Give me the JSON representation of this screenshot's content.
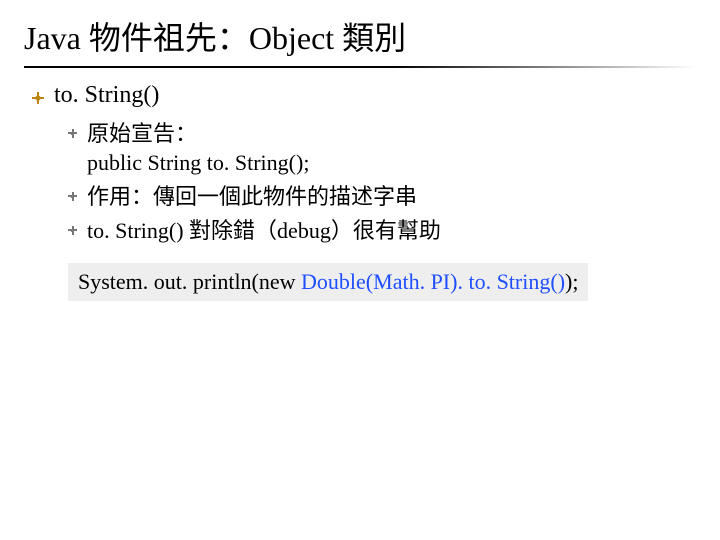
{
  "title": "Java 物件祖先：Object 類別",
  "section": "to. String()",
  "items": [
    {
      "line1": "原始宣告：",
      "line2": "public String to. String();"
    },
    {
      "line1": "作用：傳回一個此物件的描述字串"
    },
    {
      "line1": "to. String() 對除錯（debug）很有幫助"
    }
  ],
  "code": {
    "prefix": "System. out. println(new ",
    "blue": "Double(Math. PI). to. String()",
    "suffix": ");"
  }
}
